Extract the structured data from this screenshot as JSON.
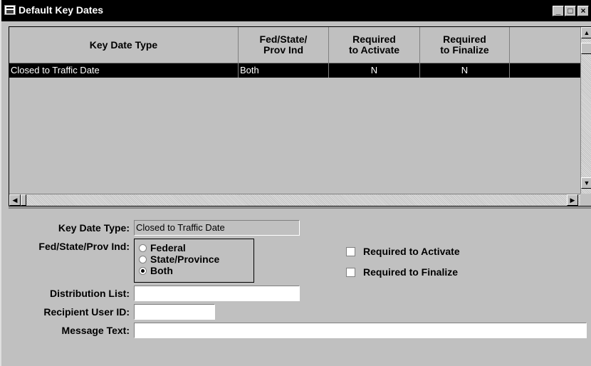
{
  "window": {
    "title": "Default Key Dates",
    "controls": {
      "minimize": "_",
      "maximize": "□",
      "close": "×"
    }
  },
  "grid": {
    "columns": [
      {
        "line1": "Key Date Type",
        "line2": ""
      },
      {
        "line1": "Fed/State/",
        "line2": "Prov Ind"
      },
      {
        "line1": "Required",
        "line2": "to Activate"
      },
      {
        "line1": "Required",
        "line2": "to Finalize"
      }
    ],
    "rows": [
      {
        "key_date_type": "Closed to Traffic Date",
        "fed_state_prov": "Both",
        "req_activate": "N",
        "req_finalize": "N"
      }
    ],
    "scroll": {
      "up": "▲",
      "down": "▼",
      "left": "◀",
      "right": "▶"
    }
  },
  "form": {
    "key_date_type_label": "Key Date Type:",
    "key_date_type_value": "Closed to Traffic Date",
    "fed_state_label": "Fed/State/Prov Ind:",
    "radio_options": [
      {
        "label": "Federal",
        "selected": false
      },
      {
        "label": "State/Province",
        "selected": false
      },
      {
        "label": "Both",
        "selected": true
      }
    ],
    "required_activate_label": "Required to Activate",
    "required_finalize_label": "Required to Finalize",
    "distribution_list_label": "Distribution List:",
    "distribution_list_value": "",
    "recipient_user_id_label": "Recipient User ID:",
    "recipient_user_id_value": "",
    "message_text_label": "Message Text:",
    "message_text_value": ""
  }
}
